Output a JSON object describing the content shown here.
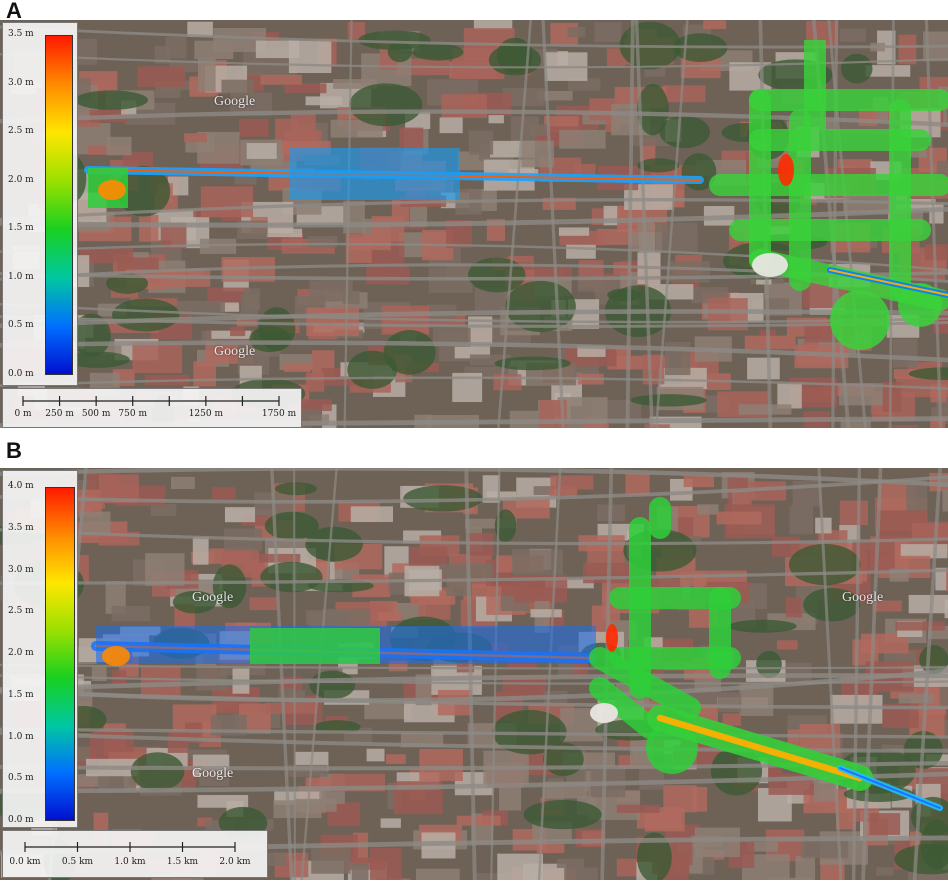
{
  "panels": [
    {
      "letter": "A",
      "legend": {
        "ticks": [
          "3.5 m",
          "3.0 m",
          "2.5 m",
          "2.0 m",
          "1.5 m",
          "1.0 m",
          "0.5 m",
          "0.0 m"
        ],
        "min": 0.0,
        "max": 3.5
      },
      "scale": {
        "labels": [
          "0 m",
          "250 m",
          "500 m",
          "750 m",
          "1250 m",
          "1750 m"
        ],
        "values": [
          0,
          250,
          500,
          750,
          1250,
          1750
        ],
        "extra_ticks": [
          1000,
          1500
        ],
        "max": 1750
      },
      "watermarks": [
        "Google",
        "Google"
      ]
    },
    {
      "letter": "B",
      "legend": {
        "ticks": [
          "4.0 m",
          "3.5 m",
          "3.0 m",
          "2.5 m",
          "2.0 m",
          "1.5 m",
          "1.0 m",
          "0.5 m",
          "0.0 m"
        ],
        "min": 0.0,
        "max": 4.0
      },
      "scale": {
        "labels": [
          "0.0 km",
          "0.5 km",
          "1.0 km",
          "1.5 km",
          "2.0 km"
        ],
        "values": [
          0,
          0.5,
          1.0,
          1.5,
          2.0
        ],
        "extra_ticks": [],
        "max": 2.0
      },
      "watermarks": [
        "Google",
        "Google",
        "Google"
      ]
    }
  ],
  "colors": {
    "ramp": [
      "#ff1a00",
      "#ff8a00",
      "#ffe600",
      "#9be000",
      "#19d020",
      "#00c8a0",
      "#0070ff",
      "#0010d0"
    ],
    "basemap": "#6e6257",
    "roofs": "#a8645a",
    "vegetation": "#3c5a34"
  }
}
